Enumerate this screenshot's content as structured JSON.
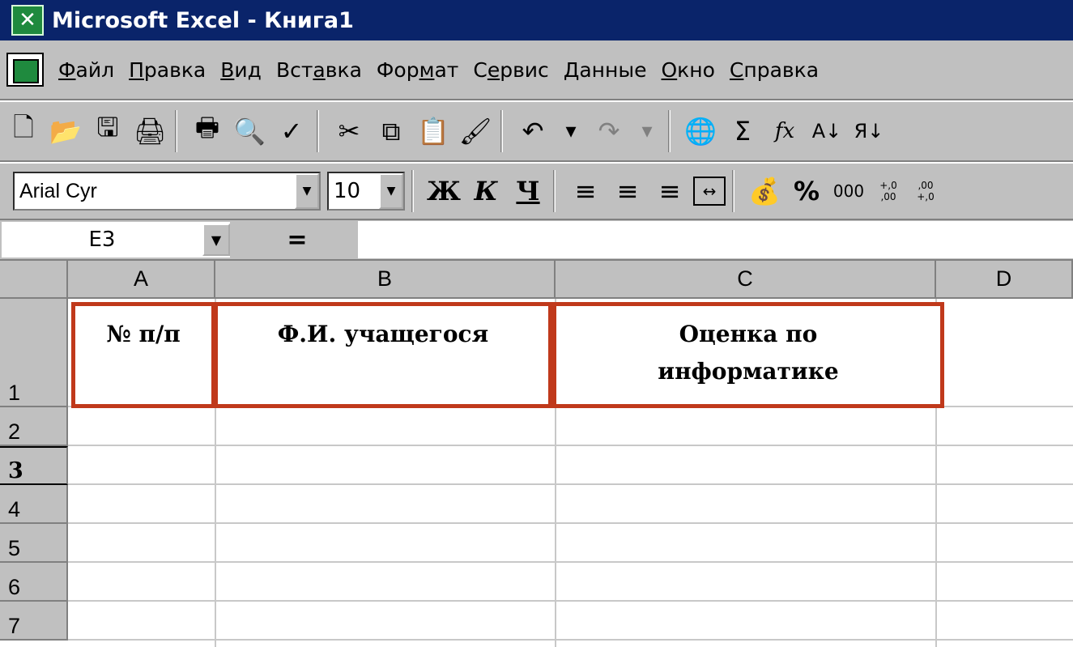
{
  "window": {
    "title": "Microsoft Excel - Книга1"
  },
  "menu": {
    "items": [
      {
        "first": "Ф",
        "rest": "айл"
      },
      {
        "first": "П",
        "rest": "равка"
      },
      {
        "first": "В",
        "rest": "ид"
      },
      {
        "pre": "Вст",
        "first": "а",
        "rest": "вка"
      },
      {
        "pre": "Фор",
        "first": "м",
        "rest": "ат"
      },
      {
        "pre": "С",
        "first": "е",
        "rest": "рвис"
      },
      {
        "first": "Д",
        "rest": "анные"
      },
      {
        "first": "О",
        "rest": "кно"
      },
      {
        "first": "С",
        "rest": "правка"
      }
    ]
  },
  "format_toolbar": {
    "font": "Arial Cyr",
    "size": "10",
    "bold": "Ж",
    "italic": "К",
    "underline": "Ч",
    "percent": "%",
    "thousands": "000",
    "inc_decimal": "+,0 ,00",
    "dec_decimal": ",00 +,0"
  },
  "standard_toolbar": {
    "sum": "Σ",
    "function": "fx"
  },
  "formula_bar": {
    "name_box": "E3",
    "equals": "=",
    "formula": ""
  },
  "sheet": {
    "columns": [
      "A",
      "B",
      "C",
      "D"
    ],
    "rows": [
      "1",
      "2",
      "3",
      "4",
      "5",
      "6",
      "7"
    ],
    "active_row": "3",
    "header_cells": [
      "№ п/п",
      "Ф.И. учащегося",
      "Оценка по информатике"
    ],
    "border_color": "#c0391b"
  }
}
